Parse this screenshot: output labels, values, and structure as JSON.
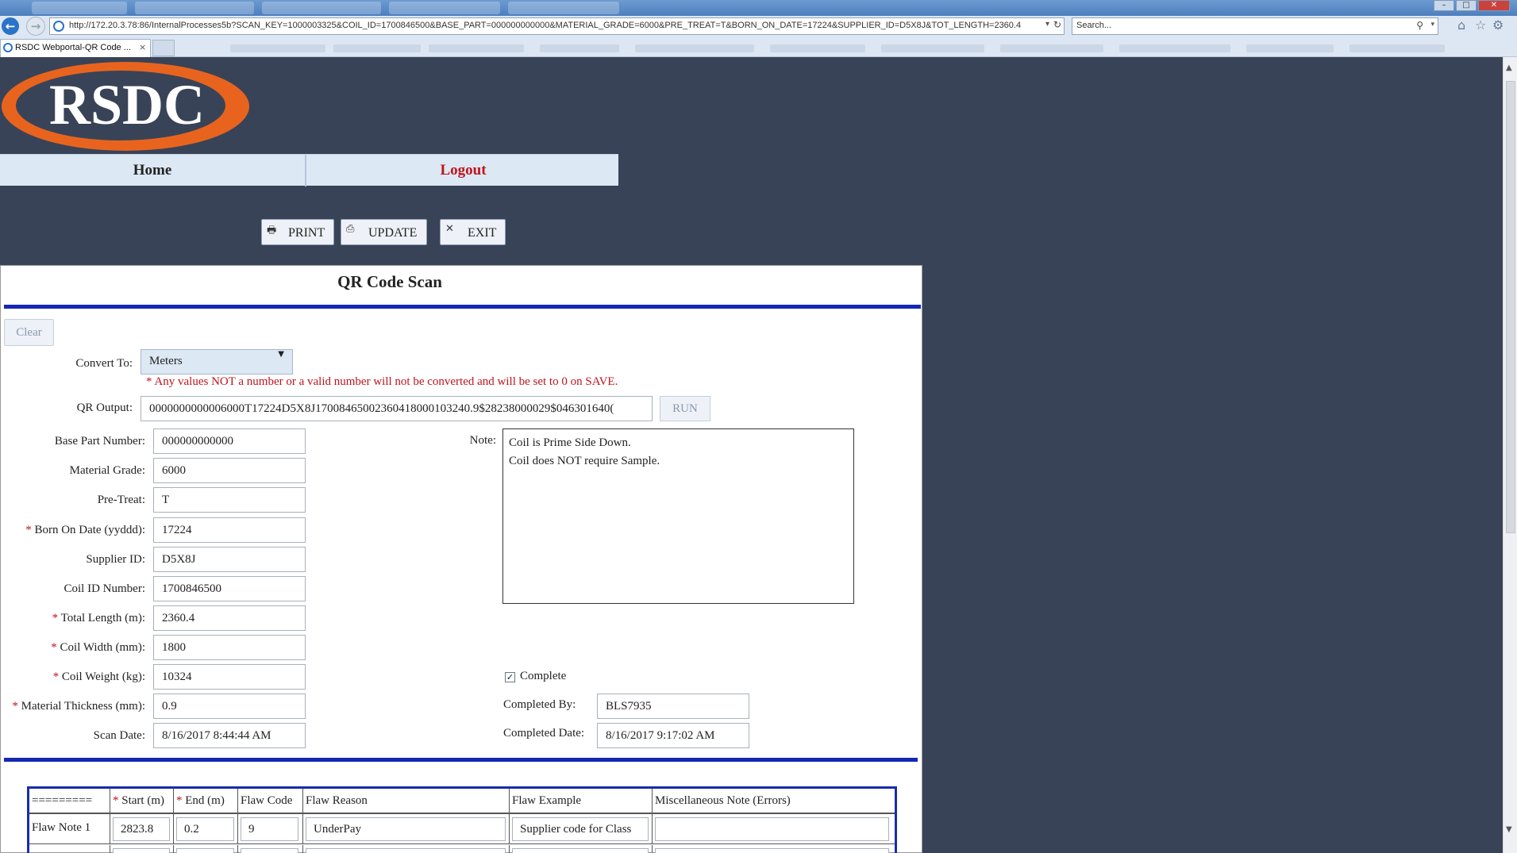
{
  "browser": {
    "url": "http://172.20.3.78:86/InternalProcesses5b?SCAN_KEY=1000003325&COIL_ID=1700846500&BASE_PART=000000000000&MATERIAL_GRADE=6000&PRE_TREAT=T&BORN_ON_DATE=17224&SUPPLIER_ID=D5X8J&TOT_LENGTH=2360.4",
    "search_placeholder": "Search...",
    "tab_title": "RSDC Webportal-QR Code ...",
    "tab_close": "×"
  },
  "logo": {
    "text": "RSDC",
    "colors": {
      "ring": "#e8641e",
      "fill": "#394357",
      "text": "#ffffff"
    }
  },
  "nav": {
    "home": "Home",
    "logout": "Logout"
  },
  "actions": {
    "print": "PRINT",
    "update": "UPDATE",
    "exit": "EXIT"
  },
  "form": {
    "title": "QR Code Scan",
    "clear_label": "Clear",
    "convert_label": "Convert To:",
    "convert_value": "Meters",
    "warning": "* Any values NOT a number or a valid number will not be converted and will be set to 0 on SAVE.",
    "qr_label": "QR Output:",
    "qr_value": "0000000000006000T17224D5X8J17008465002360418000103240.9$28238000029$046301640(",
    "run_label": "RUN",
    "fields": [
      {
        "label": "Base Part Number:",
        "required": false,
        "value": "000000000000"
      },
      {
        "label": "Material Grade:",
        "required": false,
        "value": "6000"
      },
      {
        "label": "Pre-Treat:",
        "required": false,
        "value": "T"
      },
      {
        "label": "Born On Date (yyddd):",
        "required": true,
        "value": "17224"
      },
      {
        "label": "Supplier ID:",
        "required": false,
        "value": "D5X8J"
      },
      {
        "label": "Coil ID Number:",
        "required": false,
        "value": "1700846500"
      },
      {
        "label": "Total Length (m):",
        "required": true,
        "value": "2360.4"
      },
      {
        "label": "Coil Width (mm):",
        "required": true,
        "value": "1800"
      },
      {
        "label": "Coil Weight (kg):",
        "required": true,
        "value": "10324"
      },
      {
        "label": "Material Thickness (mm):",
        "required": true,
        "value": "0.9"
      },
      {
        "label": "Scan Date:",
        "required": false,
        "value": "8/16/2017 8:44:44 AM"
      }
    ],
    "note_label": "Note:",
    "note_lines": [
      "Coil is Prime Side Down.",
      "Coil does NOT require Sample."
    ],
    "complete_label": "Complete",
    "complete_checked": true,
    "completed_by_label": "Completed By:",
    "completed_by": "BLS7935",
    "completed_date_label": "Completed Date:",
    "completed_date": "8/16/2017 9:17:02 AM"
  },
  "flaw_table": {
    "headers": [
      {
        "text": "=========",
        "required": false
      },
      {
        "text": "Start (m)",
        "required": true
      },
      {
        "text": "End (m)",
        "required": true
      },
      {
        "text": "Flaw Code",
        "required": false
      },
      {
        "text": "Flaw Reason",
        "required": false
      },
      {
        "text": "Flaw Example",
        "required": false
      },
      {
        "text": "Miscellaneous Note (Errors)",
        "required": false
      }
    ],
    "rows": [
      {
        "label": "Flaw Note 1",
        "start": "2823.8",
        "end": "0.2",
        "code": "9",
        "reason": "UnderPay",
        "example": "Supplier code for Class",
        "misc": ""
      }
    ]
  },
  "colors": {
    "page_bg": "#394357",
    "rule_blue": "#1428b4",
    "required_red": "#c0141b"
  }
}
